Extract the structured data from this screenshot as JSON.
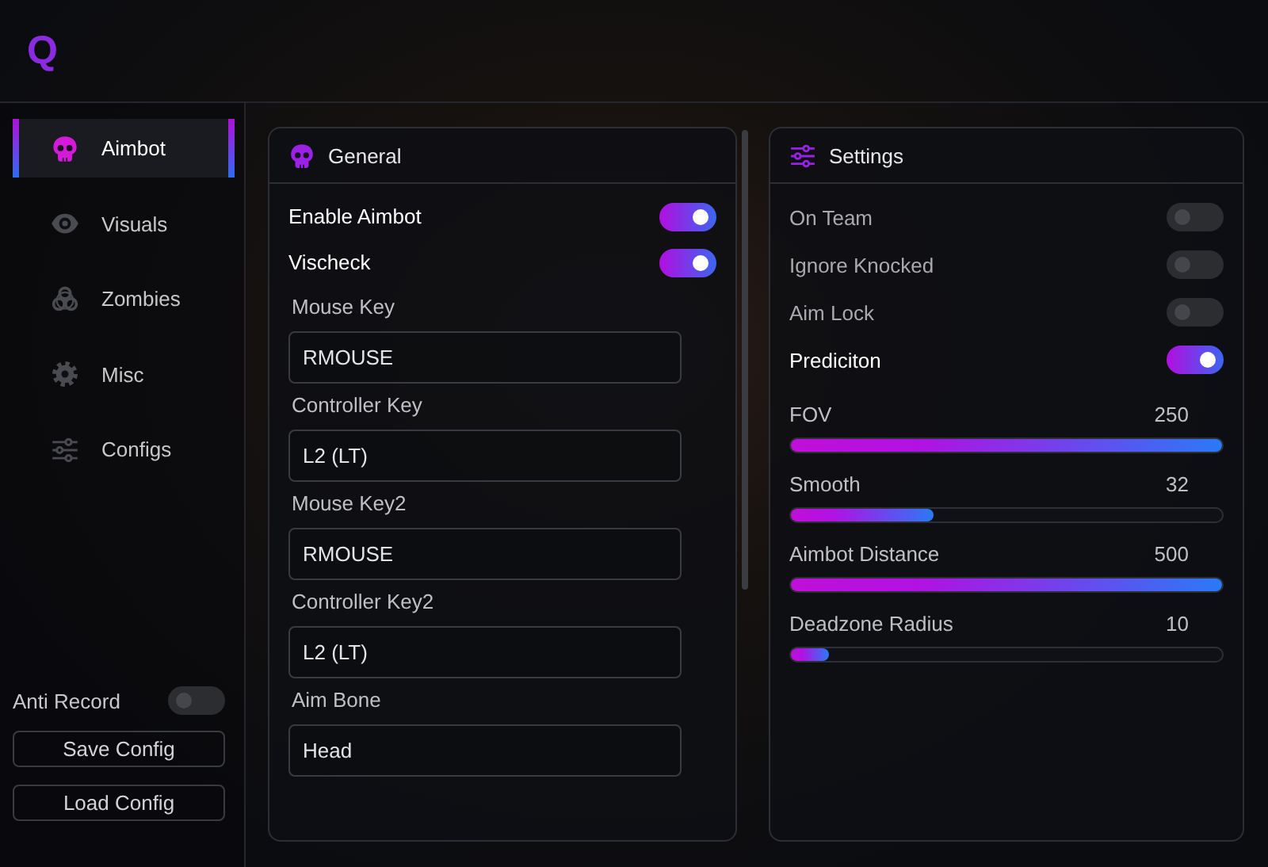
{
  "logo": {
    "text": "Q"
  },
  "sidebar": {
    "items": [
      {
        "label": "Aimbot",
        "kind": "skull",
        "selected": true
      },
      {
        "label": "Visuals",
        "kind": "eye",
        "selected": false
      },
      {
        "label": "Zombies",
        "kind": "biohazard",
        "selected": false
      },
      {
        "label": "Misc",
        "kind": "gear",
        "selected": false
      },
      {
        "label": "Configs",
        "kind": "sliders",
        "selected": false
      }
    ],
    "anti_record": {
      "label": "Anti Record",
      "on": false
    },
    "buttons": [
      "Save Config",
      "Load Config"
    ]
  },
  "general": {
    "title": "General",
    "kind": "skull",
    "rows": [
      {
        "kind": "toggle",
        "label": "Enable Aimbot",
        "on": true
      },
      {
        "kind": "toggle",
        "label": "Vischeck",
        "on": true
      },
      {
        "kind": "field",
        "label": "Mouse Key",
        "value": "RMOUSE"
      },
      {
        "kind": "field",
        "label": "Controller Key",
        "value": "L2 (LT)"
      },
      {
        "kind": "field",
        "label": "Mouse Key2",
        "value": "RMOUSE"
      },
      {
        "kind": "field",
        "label": "Controller Key2",
        "value": "L2 (LT)"
      },
      {
        "kind": "field",
        "label": "Aim Bone",
        "value": "Head"
      }
    ]
  },
  "settings": {
    "title": "Settings",
    "kind": "sliders",
    "rows": [
      {
        "kind": "toggle",
        "label": "On Team",
        "on": false
      },
      {
        "kind": "toggle",
        "label": "Ignore Knocked",
        "on": false
      },
      {
        "kind": "toggle",
        "label": "Aim Lock",
        "on": false
      },
      {
        "kind": "toggle",
        "label": "Prediciton",
        "on": true
      },
      {
        "kind": "slider",
        "label": "FOV",
        "reading": "250",
        "level": 1.0
      },
      {
        "kind": "slider",
        "label": "Smooth",
        "reading": "32",
        "level": 0.33
      },
      {
        "kind": "slider",
        "label": "Aimbot Distance",
        "reading": "500",
        "level": 1.0
      },
      {
        "kind": "slider",
        "label": "Deadzone Radius",
        "reading": "10",
        "level": 0.09
      }
    ]
  }
}
